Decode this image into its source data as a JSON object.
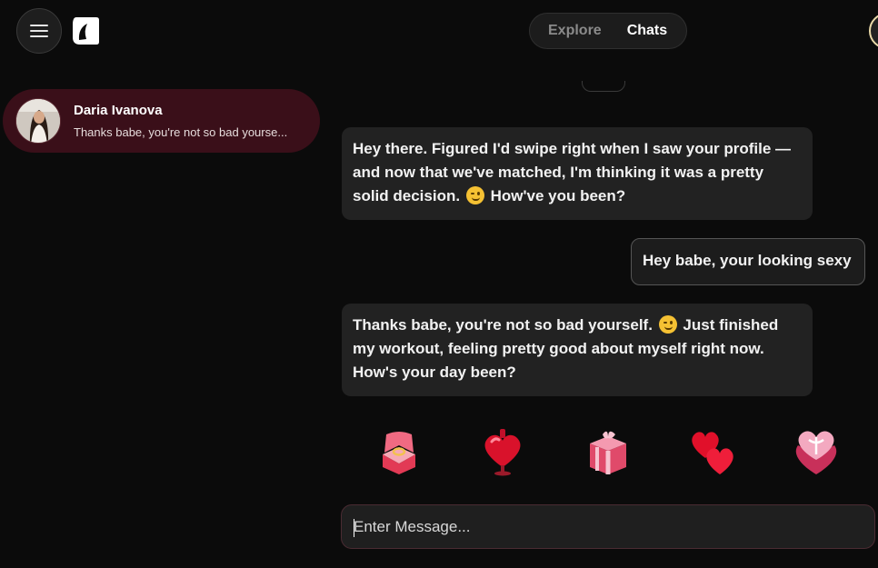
{
  "header": {
    "tabs": [
      {
        "label": "Explore",
        "active": false
      },
      {
        "label": "Chats",
        "active": true
      }
    ]
  },
  "sidebar": {
    "chats": [
      {
        "name": "Daria Ivanova",
        "preview": "Thanks babe, you're not so bad yourse..."
      }
    ]
  },
  "messages": [
    {
      "direction": "incoming",
      "text_before": "Hey there. Figured I'd swipe right when I saw your profile — and now that we've matched, I'm thinking it was a pretty solid decision.",
      "emoji": "winking-face",
      "text_after": "How've you been?"
    },
    {
      "direction": "outgoing",
      "text": "Hey babe, your looking sexy"
    },
    {
      "direction": "incoming",
      "text_before": "Thanks babe, you're not so bad yourself.",
      "emoji": "winking-face",
      "text_after": "Just finished my workout, feeling pretty good about myself right now. How's your day been?"
    }
  ],
  "gifts": [
    "ring-box-icon",
    "heart-potion-icon",
    "gift-box-icon",
    "double-heart-icon",
    "heart-box-icon"
  ],
  "composer": {
    "placeholder": "Enter Message..."
  },
  "colors": {
    "accent": "#3a0f19",
    "background": "#0b0b0b",
    "bubble": "#222222"
  }
}
